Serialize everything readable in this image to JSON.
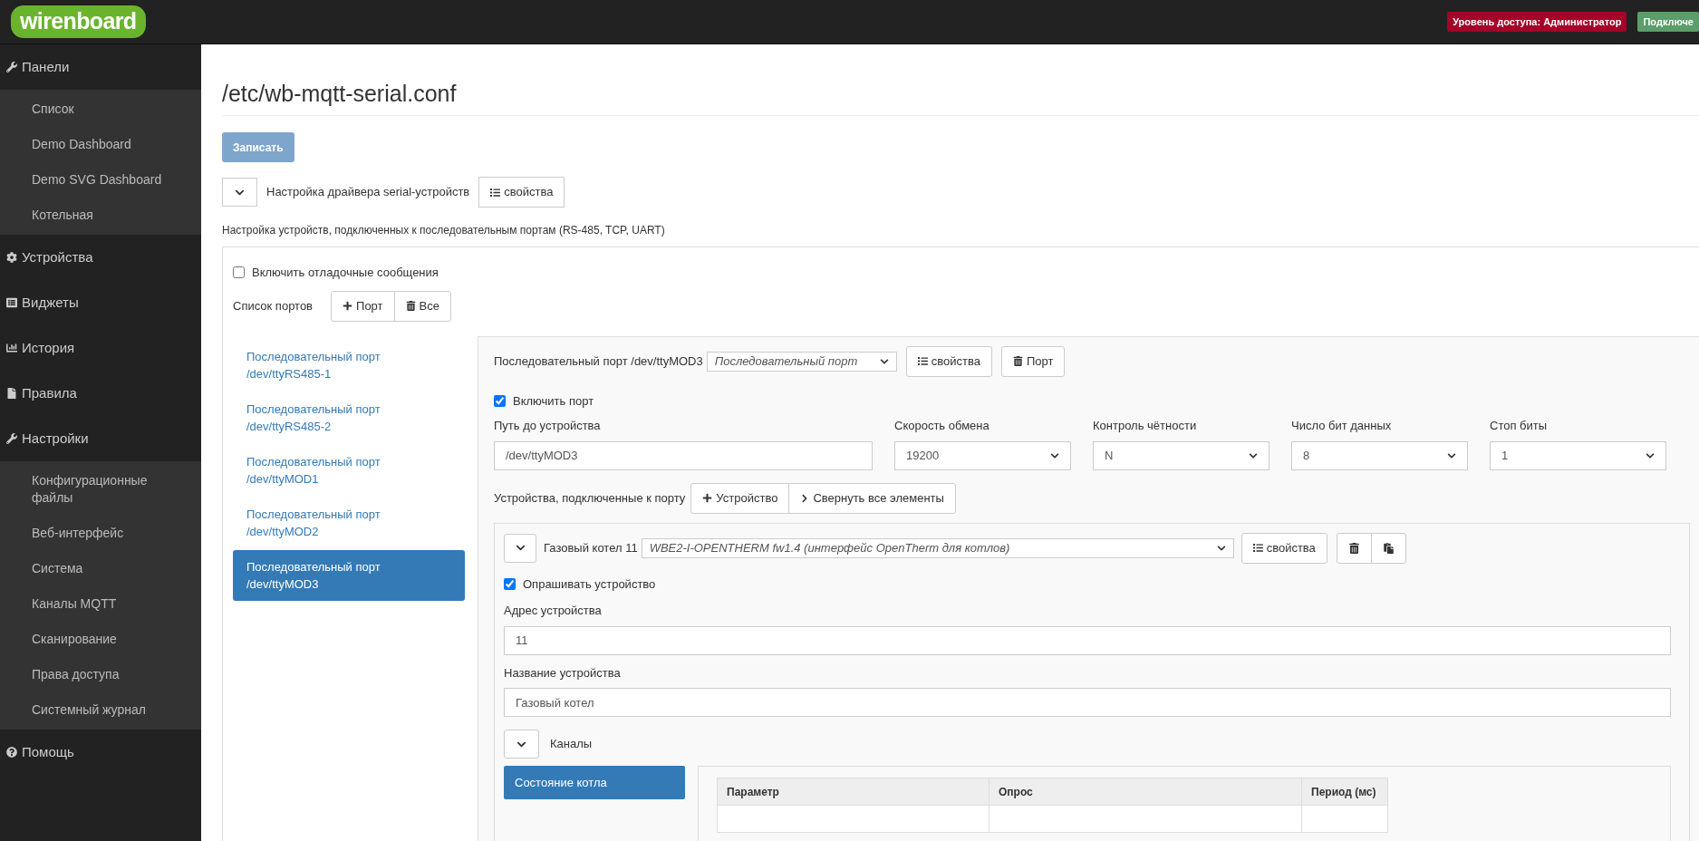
{
  "brand": "wirenboard",
  "badges": [
    {
      "text": "Уровень доступа: Администратор",
      "color": "#a50028"
    },
    {
      "text": "Подключе",
      "color": "#5a9e6a"
    }
  ],
  "sidebar": {
    "items": [
      {
        "label": "Панели",
        "children": [
          {
            "label": "Список"
          },
          {
            "label": "Demo Dashboard"
          },
          {
            "label": "Demo SVG Dashboard"
          },
          {
            "label": "Котельная"
          }
        ]
      },
      {
        "label": "Устройства"
      },
      {
        "label": "Виджеты"
      },
      {
        "label": "История"
      },
      {
        "label": "Правила"
      },
      {
        "label": "Настройки",
        "children": [
          {
            "label": "Конфигурационные файлы"
          },
          {
            "label": "Веб-интерфейс"
          },
          {
            "label": "Система"
          },
          {
            "label": "Каналы MQTT"
          },
          {
            "label": "Сканирование"
          },
          {
            "label": "Права доступа"
          },
          {
            "label": "Системный журнал"
          }
        ]
      },
      {
        "label": "Помощь"
      }
    ]
  },
  "page": {
    "title": "/etc/wb-mqtt-serial.conf",
    "save_button": {
      "label": "Записать",
      "disabled": true
    },
    "driver": {
      "title": "Настройка драйвера serial-устройств",
      "properties_button": "свойства"
    },
    "description": "Настройка устройств, подключенных к последовательным портам (RS-485, TCP, UART)",
    "debug": {
      "label": "Включить отладочные сообщения",
      "checked": false
    },
    "ports": {
      "label": "Список портов",
      "add_button": "Порт",
      "delete_button": "Все",
      "items": [
        {
          "label": "Последовательный порт",
          "path": "/dev/ttyRS485-1",
          "selected": false
        },
        {
          "label": "Последовательный порт",
          "path": "/dev/ttyRS485-2",
          "selected": false
        },
        {
          "label": "Последовательный порт",
          "path": "/dev/ttyMOD1",
          "selected": false
        },
        {
          "label": "Последовательный порт",
          "path": "/dev/ttyMOD2",
          "selected": false
        },
        {
          "label": "Последовательный порт",
          "path": "/dev/ttyMOD3",
          "selected": true
        }
      ]
    },
    "port_panel": {
      "title": "Последовательный порт /dev/ttyMOD3",
      "type_select": "Последовательный порт",
      "properties_button": "свойства",
      "delete_button": "Порт",
      "enable": {
        "label": "Включить порт",
        "checked": true
      },
      "fields": [
        {
          "label": "Путь до устройства",
          "value": "/dev/ttyMOD3",
          "kind": "text"
        },
        {
          "label": "Скорость обмена",
          "value": "19200",
          "kind": "select"
        },
        {
          "label": "Контроль чётности",
          "value": "N",
          "kind": "select"
        },
        {
          "label": "Число бит данных",
          "value": "8",
          "kind": "select"
        },
        {
          "label": "Стоп биты",
          "value": "1",
          "kind": "select"
        }
      ],
      "devices_label": "Устройства, подключенные к порту",
      "add_device_button": "Устройство",
      "collapse_button": "Свернуть все элементы"
    },
    "device": {
      "title": "Газовый котел 11",
      "template": "WBE2-I-OPENTHERM fw1.4 (интерфейс OpenTherm для котлов)",
      "properties_button": "свойства",
      "poll": {
        "label": "Опрашивать устройство",
        "checked": true
      },
      "fields": [
        {
          "label": "Адрес устройства",
          "value": "11"
        },
        {
          "label": "Название устройства",
          "value": "Газовый котел"
        }
      ],
      "channels_label": "Каналы",
      "groups": [
        {
          "label": "Состояние котла",
          "selected": true
        }
      ],
      "table": {
        "columns": [
          "Параметр",
          "Опрос",
          "Период (мс)"
        ]
      }
    }
  }
}
